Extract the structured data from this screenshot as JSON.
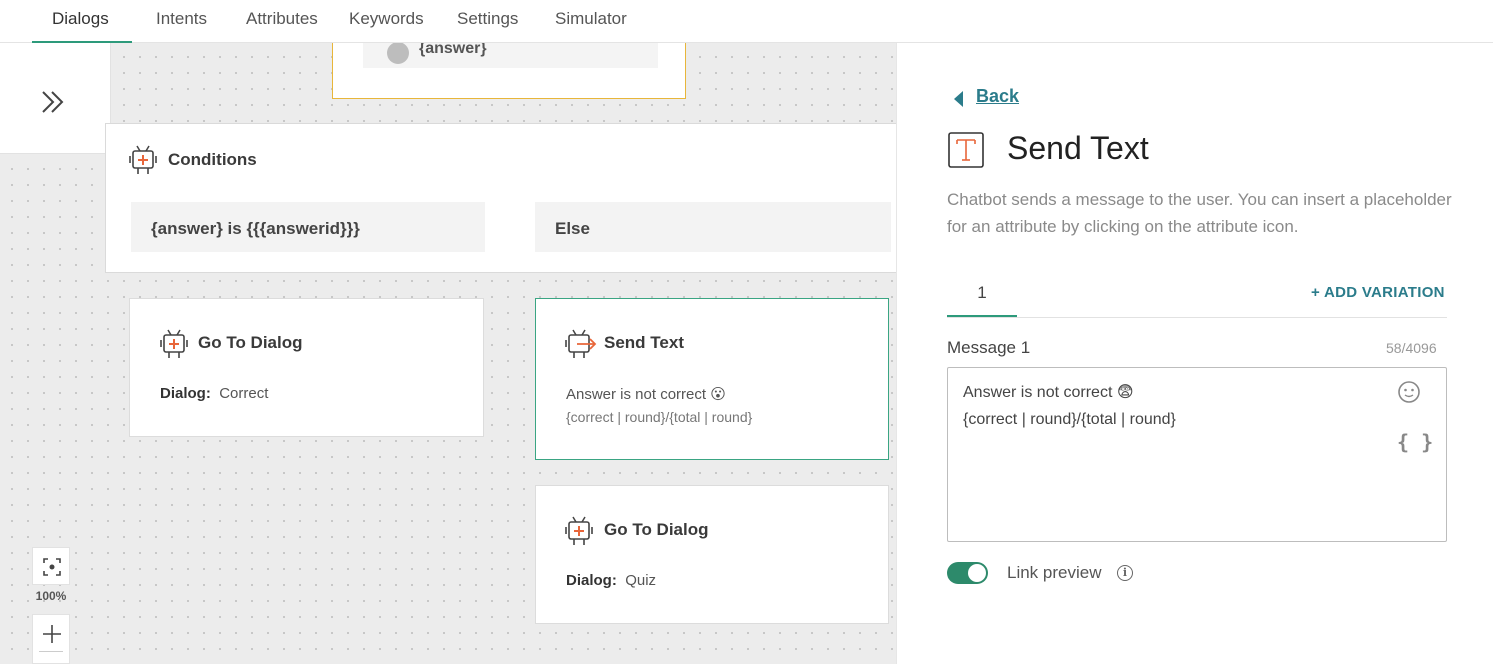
{
  "nav": {
    "tabs": [
      {
        "label": "Dialogs",
        "active": true
      },
      {
        "label": "Intents"
      },
      {
        "label": "Attributes"
      },
      {
        "label": "Keywords"
      },
      {
        "label": "Settings"
      },
      {
        "label": "Simulator"
      }
    ]
  },
  "canvas": {
    "answer_card": {
      "text": "{answer}"
    },
    "conditions": {
      "title": "Conditions",
      "branches": [
        "{answer} is {{{answerid}}}",
        "Else"
      ]
    },
    "goto_correct": {
      "title": "Go To Dialog",
      "label": "Dialog:",
      "value": "Correct"
    },
    "send_text": {
      "title": "Send Text",
      "line1": "Answer is not correct 😮",
      "line2": "{correct | round}/{total | round}"
    },
    "goto_quiz": {
      "title": "Go To Dialog",
      "label": "Dialog:",
      "value": "Quiz"
    },
    "zoom": {
      "level": "100%"
    }
  },
  "panel": {
    "back_label": "Back",
    "title": "Send Text",
    "description": "Chatbot sends a message to the user. You can insert a placeholder for an attribute by clicking on the attribute icon.",
    "variation_tab": "1",
    "add_variation": "+ ADD VARIATION",
    "message_title": "Message 1",
    "char_count": "58/4096",
    "message_lines": [
      "Answer is not correct 😨",
      "{correct | round}/{total | round}"
    ],
    "attribute_icon": "{ }",
    "link_preview_label": "Link preview",
    "link_preview_on": true
  },
  "colors": {
    "accent": "#2d9a7b",
    "link": "#2b7c8b",
    "bot_orange": "#e8663a",
    "answer_border": "#e8b63a"
  }
}
